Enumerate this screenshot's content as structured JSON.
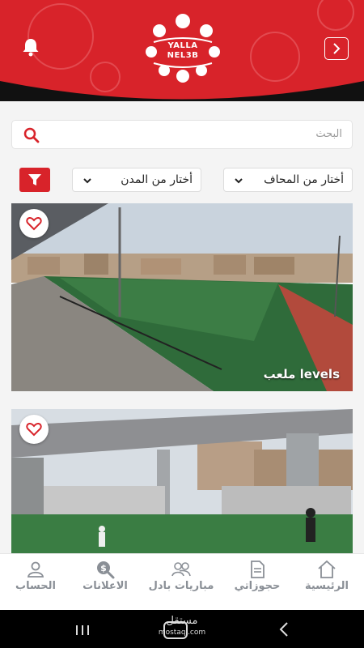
{
  "header": {
    "logo_line1": "YALLA",
    "logo_line2": "NEL3B",
    "brand_color": "#d8232a"
  },
  "search": {
    "placeholder": "البحث"
  },
  "filters": {
    "governorate_label": "أختار من المحاف",
    "city_label": "أختار من المدن"
  },
  "cards": [
    {
      "title": "ملعب levels"
    },
    {
      "title": ""
    }
  ],
  "nav": {
    "items": [
      {
        "label": "الرئيسية",
        "icon": "home-icon"
      },
      {
        "label": "حجوزاتي",
        "icon": "bookings-icon"
      },
      {
        "label": "مباريات بادل",
        "icon": "players-icon"
      },
      {
        "label": "الاعلانات",
        "icon": "ads-icon"
      },
      {
        "label": "الحساب",
        "icon": "account-icon"
      }
    ]
  },
  "watermark": {
    "line1": "مستقل",
    "line2": "mostaql.com"
  }
}
